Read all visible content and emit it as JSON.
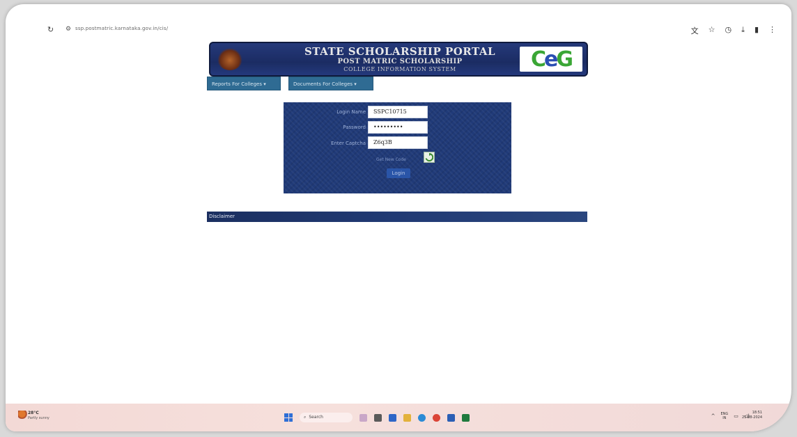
{
  "browser": {
    "url": "ssp.postmatric.karnataka.gov.in/cis/",
    "toolbar_icons": [
      "translate-icon",
      "star-icon",
      "history-icon",
      "download-icon",
      "extension-icon",
      "menu-icon"
    ]
  },
  "banner": {
    "title": "STATE SCHOLARSHIP PORTAL",
    "subtitle": "POST MATRIC SCHOLARSHIP",
    "system": "COLLEGE INFORMATION SYSTEM",
    "logo_text": "CeG"
  },
  "nav": {
    "reports": "Reports For Colleges ▾",
    "documents": "Documents For Colleges ▾"
  },
  "login": {
    "login_name_label": "Login Name",
    "login_name_value": "SSPC10715",
    "password_label": "Password",
    "password_value": "•••••••••",
    "captcha_label": "Enter Captcha",
    "captcha_value": "Z6q3B",
    "refresh_text": "Get New Code",
    "login_button": "Login"
  },
  "disclaimer": {
    "label": "Disclaimer"
  },
  "taskbar": {
    "weather_temp": "28°C",
    "weather_desc": "Partly sunny",
    "search_placeholder": "Search",
    "lang_line1": "ENG",
    "lang_line2": "IN",
    "time": "18:51",
    "date": "21-08-2024"
  },
  "colors": {
    "banner_bg": "#1b2c63",
    "login_panel_bg": "#203a78",
    "nav_button_bg": "#2f6b93",
    "taskbar_bg": "#f3d9d6"
  }
}
